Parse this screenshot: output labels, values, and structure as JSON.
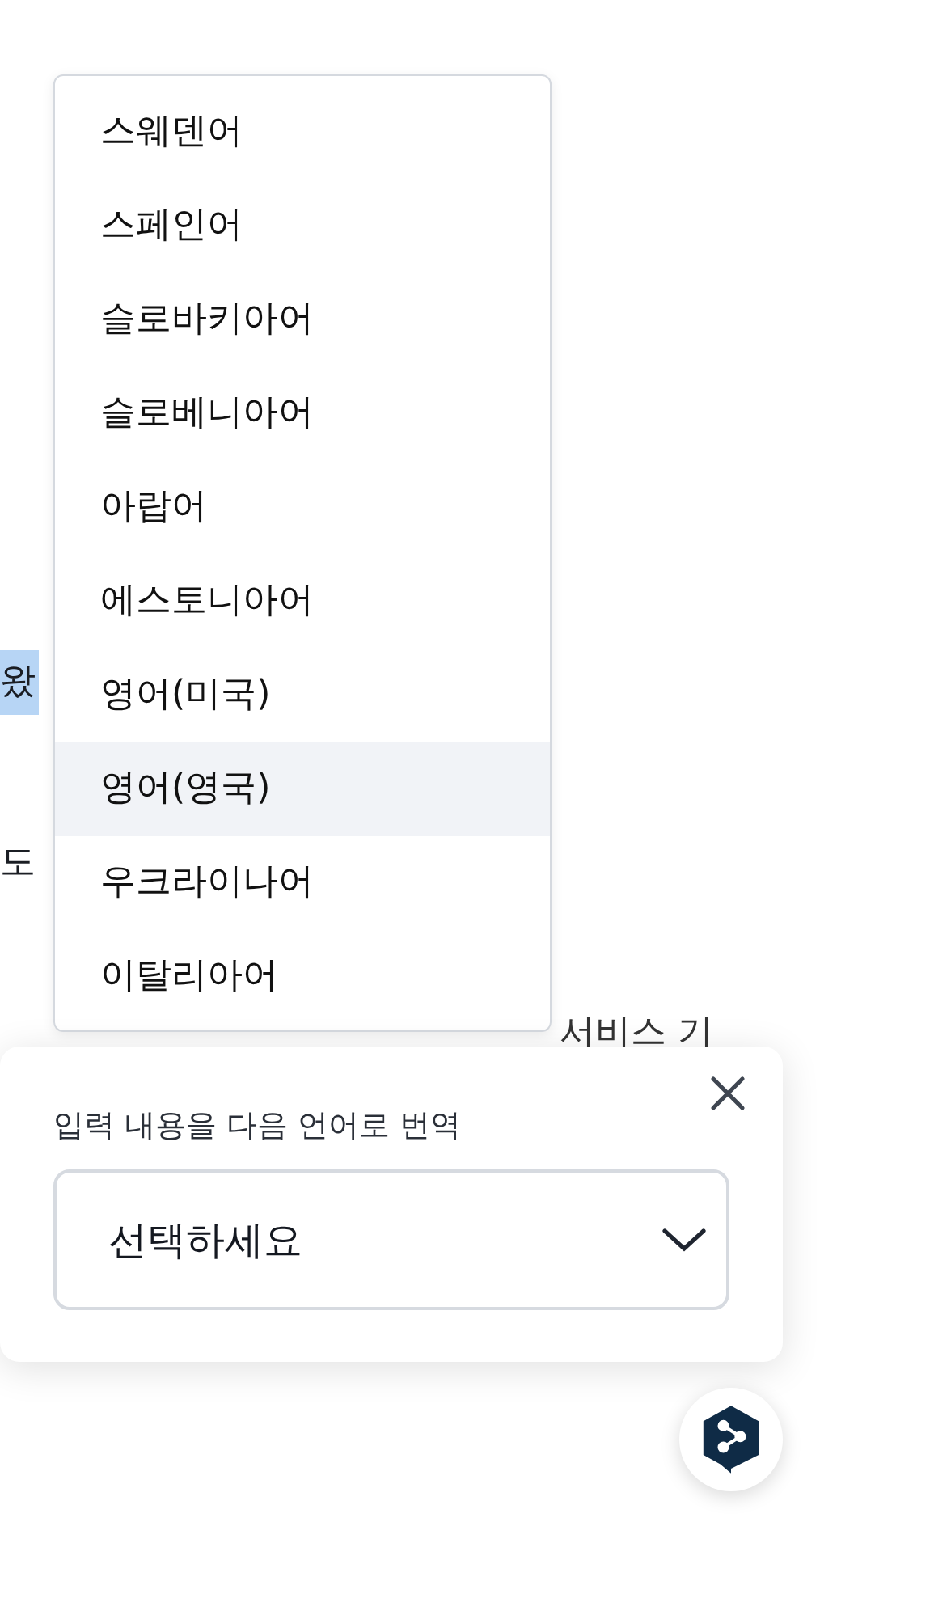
{
  "page_text": [
    {
      "text": "왔",
      "highlighted": true
    },
    {
      "text": "도",
      "highlighted": false
    },
    {
      "text": "서비스 기",
      "highlighted": false
    }
  ],
  "language_menu": {
    "items": [
      {
        "label": "스웨덴어",
        "selected": false
      },
      {
        "label": "스페인어",
        "selected": false
      },
      {
        "label": "슬로바키아어",
        "selected": false
      },
      {
        "label": "슬로베니아어",
        "selected": false
      },
      {
        "label": "아랍어",
        "selected": false
      },
      {
        "label": "에스토니아어",
        "selected": false
      },
      {
        "label": "영어(미국)",
        "selected": false
      },
      {
        "label": "영어(영국)",
        "selected": true
      },
      {
        "label": "우크라이나어",
        "selected": false
      },
      {
        "label": "이탈리아어",
        "selected": false
      }
    ]
  },
  "translate_panel": {
    "label": "입력 내용을 다음 언어로 번역",
    "select": {
      "placeholder": "선택하세요"
    }
  }
}
